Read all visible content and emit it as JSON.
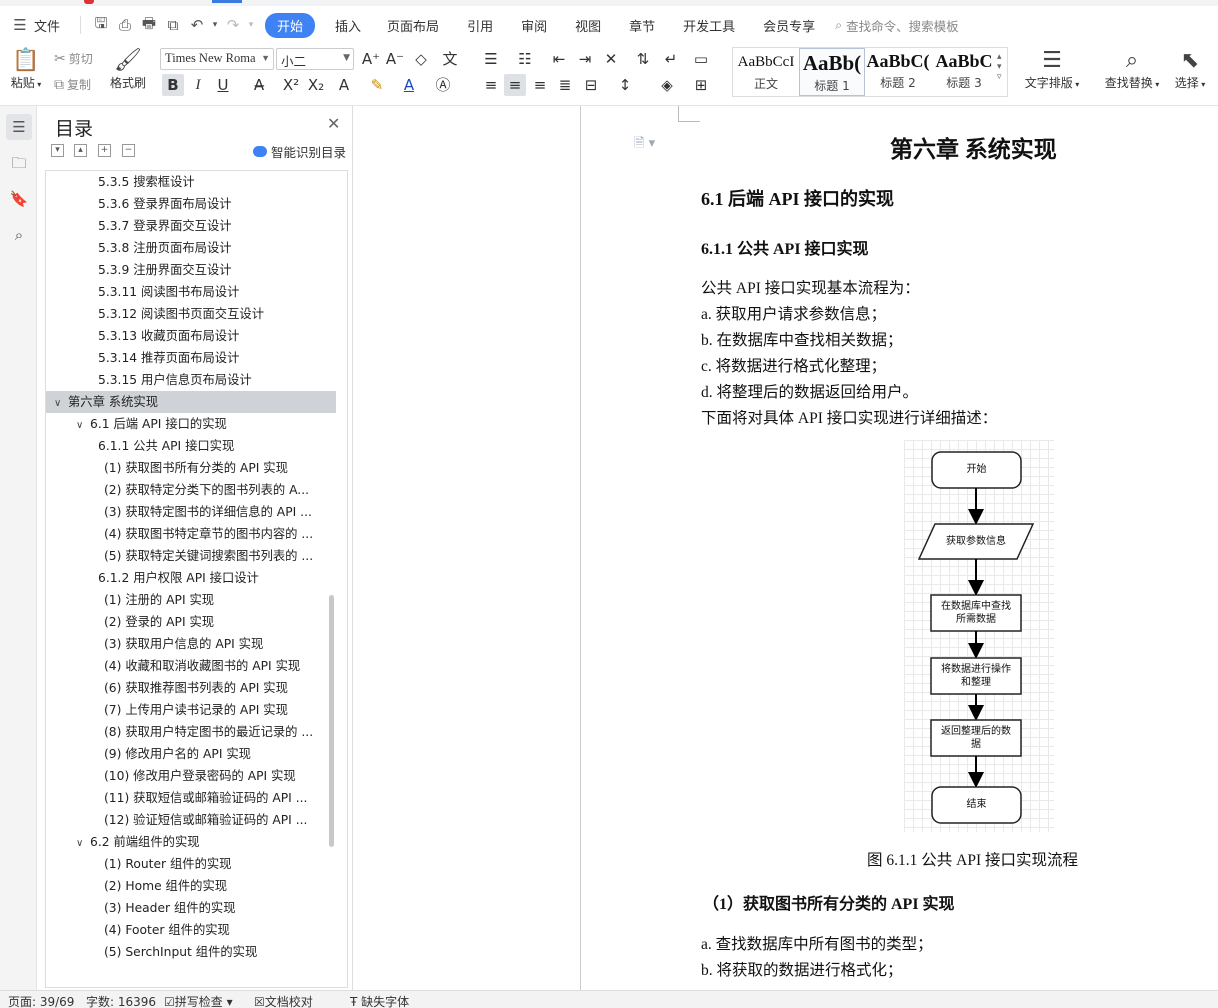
{
  "menu": {
    "file_label": "文件",
    "tabs": [
      "开始",
      "插入",
      "页面布局",
      "引用",
      "审阅",
      "视图",
      "章节",
      "开发工具",
      "会员专享"
    ],
    "search_placeholder": "查找命令、搜索模板"
  },
  "ribbon": {
    "paste": "粘贴",
    "cut": "剪切",
    "copy": "复制",
    "format_painter": "格式刷",
    "font_name": "Times New Roma",
    "font_size": "小二",
    "styles": [
      {
        "preview": "AaBbCcI",
        "name": "正文"
      },
      {
        "preview": "AaBb(",
        "name": "标题 1"
      },
      {
        "preview": "AaBbC(",
        "name": "标题 2"
      },
      {
        "preview": "AaBbC",
        "name": "标题 3"
      }
    ],
    "text_layout": "文字排版",
    "find_replace": "查找替换",
    "select": "选择"
  },
  "nav": {
    "title": "目录",
    "smart_toc": "智能识别目录",
    "selected_index": 11,
    "items": [
      {
        "text": "5.3.5  搜索框设计",
        "level": 3
      },
      {
        "text": "5.3.6 登录界面布局设计",
        "level": 3
      },
      {
        "text": "5.3.7  登录界面交互设计",
        "level": 3
      },
      {
        "text": "5.3.8  注册页面布局设计",
        "level": 3
      },
      {
        "text": "5.3.9 注册界面交互设计",
        "level": 3
      },
      {
        "text": "5.3.11 阅读图书布局设计",
        "level": 3
      },
      {
        "text": "5.3.12  阅读图书页面交互设计",
        "level": 3
      },
      {
        "text": "5.3.13  收藏页面布局设计",
        "level": 3
      },
      {
        "text": "5.3.14  推荐页面布局设计",
        "level": 3
      },
      {
        "text": "5.3.15  用户信息页布局设计",
        "level": 3
      },
      {
        "text": "第六章  系统实现",
        "level": 1
      },
      {
        "text": "6.1 后端 API 接口的实现",
        "level": 2
      },
      {
        "text": "6.1.1 公共 API 接口实现",
        "level": 3
      },
      {
        "text": "(1)  获取图书所有分类的 API 实现",
        "level": 4
      },
      {
        "text": "(2)  获取特定分类下的图书列表的 A...",
        "level": 4
      },
      {
        "text": "(3)  获取特定图书的详细信息的 API ...",
        "level": 4
      },
      {
        "text": "(4)  获取图书特定章节的图书内容的 ...",
        "level": 4
      },
      {
        "text": "(5)  获取特定关键词搜索图书列表的 ...",
        "level": 4
      },
      {
        "text": "6.1.2  用户权限 API 接口设计",
        "level": 3
      },
      {
        "text": "(1)  注册的 API 实现",
        "level": 4
      },
      {
        "text": "(2)  登录的 API 实现",
        "level": 4
      },
      {
        "text": "(3)  获取用户信息的 API 实现",
        "level": 4
      },
      {
        "text": "(4)  收藏和取消收藏图书的 API 实现",
        "level": 4
      },
      {
        "text": "(6)  获取推荐图书列表的 API 实现",
        "level": 4
      },
      {
        "text": "(7)  上传用户读书记录的 API 实现",
        "level": 4
      },
      {
        "text": "(8)  获取用户特定图书的最近记录的 ...",
        "level": 4
      },
      {
        "text": "(9)  修改用户名的 API 实现",
        "level": 4
      },
      {
        "text": "(10)  修改用户登录密码的 API 实现",
        "level": 4
      },
      {
        "text": "(11)  获取短信或邮箱验证码的 API ...",
        "level": 4
      },
      {
        "text": "(12)  验证短信或邮箱验证码的 API ...",
        "level": 4
      },
      {
        "text": "6.2 前端组件的实现",
        "level": 2
      },
      {
        "text": "(1)  Router 组件的实现",
        "level": 4
      },
      {
        "text": "(2)  Home 组件的实现",
        "level": 4
      },
      {
        "text": "(3)  Header 组件的实现",
        "level": 4
      },
      {
        "text": "(4)  Footer 组件的实现",
        "level": 4
      },
      {
        "text": "(5)  SerchInput 组件的实现",
        "level": 4
      }
    ]
  },
  "doc": {
    "chapter": "第六章  系统实现",
    "h2": "6.1 后端 API 接口的实现",
    "h3": "6.1.1 公共 API 接口实现",
    "intro": "公共 API 接口实现基本流程为：",
    "steps": [
      "a.   获取用户请求参数信息；",
      "b.   在数据库中查找相关数据；",
      "c.   将数据进行格式化整理；",
      "d.   将整理后的数据返回给用户。"
    ],
    "detail": "下面将对具体 API 接口实现进行详细描述：",
    "flow": [
      "开始",
      "获取参数信息",
      "在数据库中查找\n所需数据",
      "将数据进行操作\n和整理",
      "返回整理后的数\n据",
      "结束"
    ],
    "figure_caption": "图 6.1.1  公共 API 接口实现流程",
    "h4": "（1）获取图书所有分类的 API 实现",
    "sub_steps": [
      "a.  查找数据库中所有图书的类型；",
      "b.  将获取的数据进行格式化；"
    ]
  },
  "status": {
    "page": "页面: 39/69",
    "words": "字数: 16396",
    "spell": "拼写检查",
    "proof": "文档校对",
    "missing_font": "缺失字体"
  }
}
